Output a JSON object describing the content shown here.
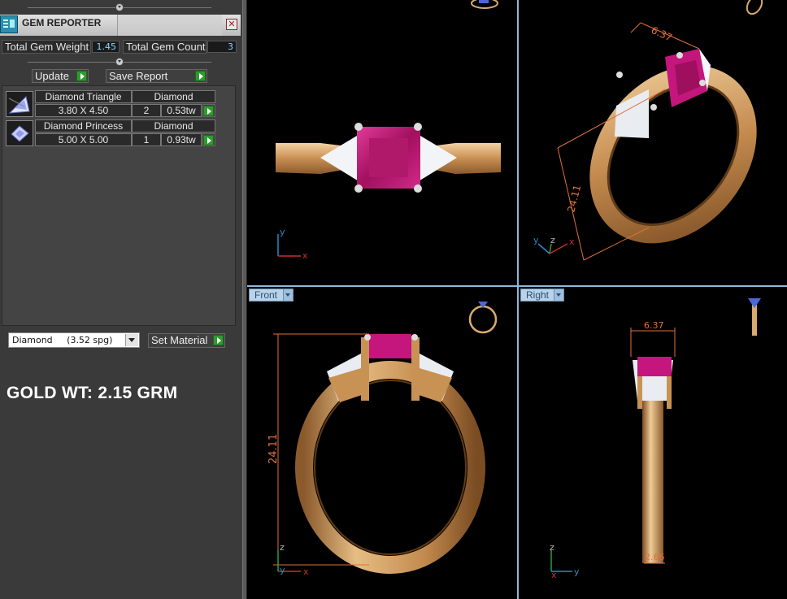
{
  "panel": {
    "title": "GEM REPORTER",
    "close_glyph": "✕",
    "total_gem_weight_label": "Total Gem Weight",
    "total_gem_weight_value": "1.45",
    "total_gem_count_label": "Total Gem Count",
    "total_gem_count_value": "3",
    "update_label": "Update",
    "save_report_label": "Save Report",
    "gems": [
      {
        "name": "Diamond Triangle",
        "material": "Diamond",
        "size": "3.80 X 4.50",
        "count": "2",
        "weight": "0.53tw",
        "icon": "triangle-gem-icon"
      },
      {
        "name": "Diamond Princess",
        "material": "Diamond",
        "size": "5.00 X 5.00",
        "count": "1",
        "weight": "0.93tw",
        "icon": "princess-gem-icon"
      }
    ],
    "material_select_value": "Diamond     (3.52 spg)",
    "set_material_label": "Set Material",
    "gold_weight_text": "GOLD WT: 2.15 GRM"
  },
  "viewports": {
    "front_label": "Front",
    "right_label": "Right",
    "top_view": {
      "axis_y": "y",
      "axis_x": "x"
    },
    "perspective_view": {
      "axis_y": "y",
      "axis_z": "z",
      "axis_x": "x",
      "dim_width": "6.37",
      "dim_height": "24.11"
    },
    "front_view": {
      "axis_z": "z",
      "axis_y": "y",
      "axis_x": "x",
      "dim_height": "24.11"
    },
    "right_view": {
      "axis_z": "z",
      "axis_x": "x",
      "axis_y": "y",
      "dim_top": "6.37",
      "dim_bottom": "2.66"
    }
  },
  "colors": {
    "gold": "#d9a96f",
    "ruby": "#c2187a",
    "dimension": "#e0703a",
    "viewport_border": "#8fb8d8"
  }
}
